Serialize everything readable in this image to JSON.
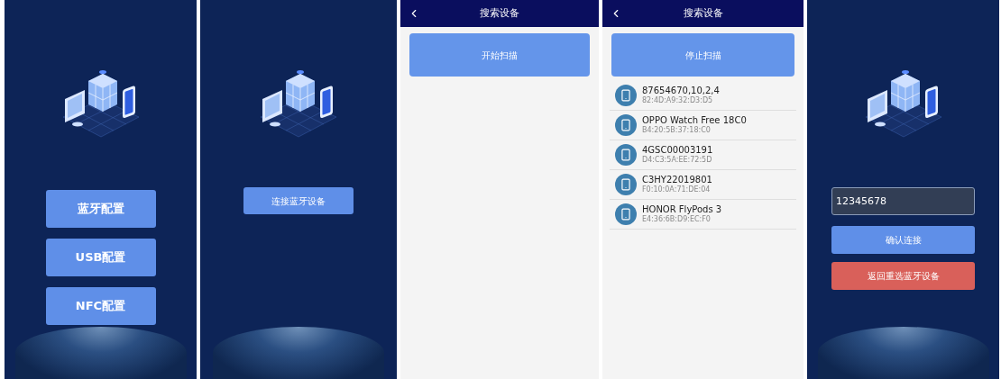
{
  "screens": [
    {
      "kind": "menu",
      "buttons": [
        "蓝牙配置",
        "USB配置",
        "NFC配置"
      ]
    },
    {
      "kind": "connect",
      "buttons": [
        "连接蓝牙设备"
      ]
    },
    {
      "kind": "scan",
      "title": "搜索设备",
      "scan_button": "开始扫描"
    },
    {
      "kind": "scan",
      "title": "搜索设备",
      "scan_button": "停止扫描",
      "devices": [
        {
          "name": "87654670,10,2,4",
          "mac": "82:4D:A9:32:D3:D5"
        },
        {
          "name": "OPPO Watch Free 18C0",
          "mac": "B4:20:5B:37:18:C0"
        },
        {
          "name": "4GSC00003191",
          "mac": "D4:C3:5A:EE:72:5D"
        },
        {
          "name": "C3HY22019801",
          "mac": "F0:10:0A:71:DE:04"
        },
        {
          "name": "HONOR FlyPods 3",
          "mac": "E4:36:6B:D9:EC:F0"
        }
      ]
    },
    {
      "kind": "password",
      "input": "12345678",
      "buttons": [
        {
          "label": "确认连接",
          "kind": "primary"
        },
        {
          "label": "返回重选蓝牙设备",
          "kind": "danger"
        }
      ]
    }
  ]
}
